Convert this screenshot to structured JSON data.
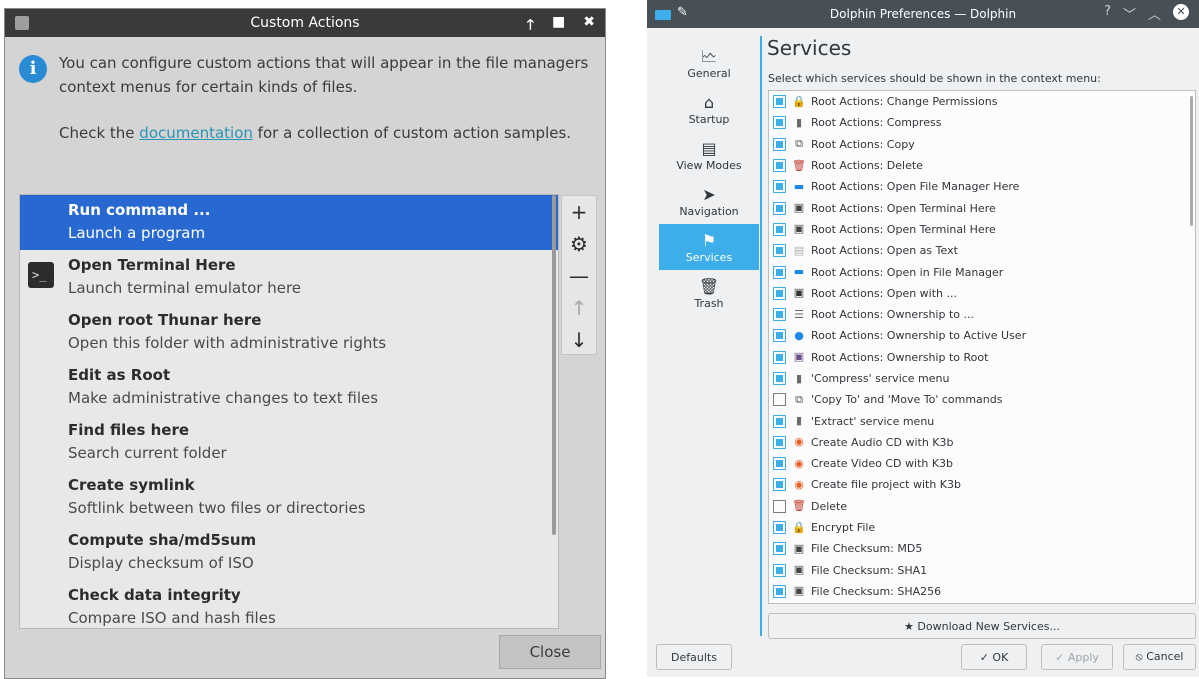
{
  "left_window": {
    "title": "Custom Actions",
    "controls": [
      "🡑",
      "■",
      "✖"
    ],
    "info_text_1": "You can configure custom actions that will appear in the file managers context menus for certain kinds of files.",
    "info_text_2_pre": "Check the ",
    "info_link": "documentation",
    "info_text_2_post": " for a collection of custom action samples.",
    "actions": [
      {
        "title": "Run command ...",
        "subtitle": "Launch a program"
      },
      {
        "title": "Open Terminal Here",
        "subtitle": "Launch terminal emulator here"
      },
      {
        "title": "Open root Thunar here",
        "subtitle": "Open this folder with administrative rights"
      },
      {
        "title": "Edit as Root",
        "subtitle": "Make administrative changes to text files"
      },
      {
        "title": "Find files here",
        "subtitle": "Search current folder"
      },
      {
        "title": "Create symlink",
        "subtitle": "Softlink between two files or directories"
      },
      {
        "title": "Compute sha/md5sum",
        "subtitle": "Display checksum of ISO"
      },
      {
        "title": "Check data integrity",
        "subtitle": "Compare ISO and hash files"
      }
    ],
    "close_label": "Close"
  },
  "right_window": {
    "title": "Dolphin Preferences — Dolphin",
    "title_controls": [
      "?",
      "﹀",
      "︿",
      "✕"
    ],
    "nav": [
      {
        "label": "General",
        "icon": "🗠"
      },
      {
        "label": "Startup",
        "icon": "⌂"
      },
      {
        "label": "View Modes",
        "icon": "▤"
      },
      {
        "label": "Navigation",
        "icon": "➤"
      },
      {
        "label": "Services",
        "icon": "⚑"
      },
      {
        "label": "Trash",
        "icon": "🗑"
      }
    ],
    "page_title": "Services",
    "subtitle": "Select which services should be shown in the context menu:",
    "services": [
      {
        "label": "Root Actions: Change Permissions",
        "checked": true,
        "icon": "🔒"
      },
      {
        "label": "Root Actions: Compress",
        "checked": true,
        "icon": "▮"
      },
      {
        "label": "Root Actions: Copy",
        "checked": true,
        "icon": "⧉"
      },
      {
        "label": "Root Actions: Delete",
        "checked": true,
        "icon": "🗑"
      },
      {
        "label": "Root Actions: Open File Manager Here",
        "checked": true,
        "icon": "▬"
      },
      {
        "label": "Root Actions: Open Terminal Here",
        "checked": true,
        "icon": "▣"
      },
      {
        "label": "Root Actions: Open Terminal Here",
        "checked": true,
        "icon": "▣"
      },
      {
        "label": "Root Actions: Open as Text",
        "checked": true,
        "icon": "▤"
      },
      {
        "label": "Root Actions: Open in File Manager",
        "checked": true,
        "icon": "▬"
      },
      {
        "label": "Root Actions: Open with ...",
        "checked": true,
        "icon": "▣"
      },
      {
        "label": "Root Actions: Ownership to ...",
        "checked": true,
        "icon": "☰"
      },
      {
        "label": "Root Actions: Ownership to Active User",
        "checked": true,
        "icon": "●"
      },
      {
        "label": "Root Actions: Ownership to Root",
        "checked": true,
        "icon": "▣"
      },
      {
        "label": "'Compress' service menu",
        "checked": true,
        "icon": "▮"
      },
      {
        "label": "'Copy To' and 'Move To' commands",
        "checked": false,
        "icon": "⧉"
      },
      {
        "label": "'Extract' service menu",
        "checked": true,
        "icon": "▮"
      },
      {
        "label": "Create Audio CD with K3b",
        "checked": true,
        "icon": "◉"
      },
      {
        "label": "Create Video CD with K3b",
        "checked": true,
        "icon": "◉"
      },
      {
        "label": "Create file project with K3b",
        "checked": true,
        "icon": "◉"
      },
      {
        "label": "Delete",
        "checked": false,
        "icon": "🗑"
      },
      {
        "label": "Encrypt File",
        "checked": true,
        "icon": "🔒"
      },
      {
        "label": "File Checksum: MD5",
        "checked": true,
        "icon": "▣"
      },
      {
        "label": "File Checksum: SHA1",
        "checked": true,
        "icon": "▣"
      },
      {
        "label": "File Checksum: SHA256",
        "checked": true,
        "icon": "▣"
      }
    ],
    "download_label": "★ Download New Services...",
    "defaults_label": "Defaults",
    "ok_label": "✓ OK",
    "apply_label": "✓ Apply",
    "cancel_label": "⦸ Cancel",
    "colors": {
      "accent": "#3daee9",
      "titlebar": "#475057"
    }
  }
}
